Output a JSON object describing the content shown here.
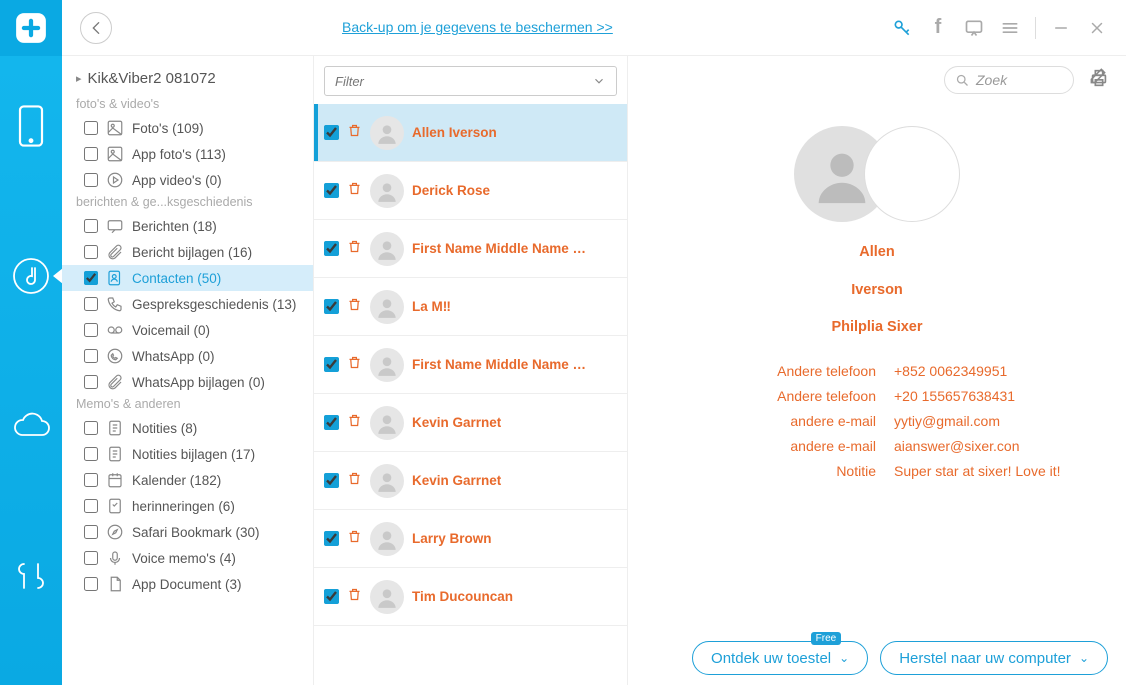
{
  "topbar": {
    "backup_link": "Back-up om je gegevens te beschermen >>"
  },
  "tools": {
    "search_placeholder": "Zoek"
  },
  "tree": {
    "title": "Kik&Viber2 081072",
    "groups": [
      {
        "label": "foto's & video's",
        "items": [
          {
            "id": "photos",
            "label": "Foto's (109)"
          },
          {
            "id": "app-photos",
            "label": "App foto's (113)"
          },
          {
            "id": "app-videos",
            "label": "App video's (0)"
          }
        ]
      },
      {
        "label": "berichten & ge...ksgeschiedenis",
        "items": [
          {
            "id": "messages",
            "label": "Berichten (18)"
          },
          {
            "id": "msg-attach",
            "label": "Bericht bijlagen (16)"
          },
          {
            "id": "contacts",
            "label": "Contacten (50)",
            "selected": true,
            "checked": true
          },
          {
            "id": "callhist",
            "label": "Gespreksgeschiedenis (13)"
          },
          {
            "id": "voicemail",
            "label": "Voicemail (0)"
          },
          {
            "id": "whatsapp",
            "label": "WhatsApp (0)"
          },
          {
            "id": "whatsapp-att",
            "label": "WhatsApp bijlagen (0)"
          }
        ]
      },
      {
        "label": "Memo's & anderen",
        "items": [
          {
            "id": "notes",
            "label": "Notities (8)"
          },
          {
            "id": "notes-att",
            "label": "Notities bijlagen (17)"
          },
          {
            "id": "calendar",
            "label": "Kalender (182)"
          },
          {
            "id": "reminders",
            "label": "herinneringen (6)"
          },
          {
            "id": "safari",
            "label": "Safari Bookmark (30)"
          },
          {
            "id": "voicememo",
            "label": "Voice memo's (4)"
          },
          {
            "id": "appdoc",
            "label": "App Document (3)"
          }
        ]
      }
    ]
  },
  "filter": {
    "label": "Filter"
  },
  "contacts": [
    {
      "name": "Allen  Iverson",
      "active": true
    },
    {
      "name": "Derick Rose"
    },
    {
      "name": "First Name Middle Name La..."
    },
    {
      "name": "La M‼"
    },
    {
      "name": "First Name Middle Name La..."
    },
    {
      "name": "Kevin Garrnet"
    },
    {
      "name": "Kevin Garrnet"
    },
    {
      "name": "Larry Brown"
    },
    {
      "name": "Tim  Ducouncan"
    }
  ],
  "detail": {
    "first": "Allen",
    "last": "Iverson",
    "company": "Philplia Sixer",
    "fields": [
      {
        "label": "Andere telefoon",
        "value": "+852 0062349951"
      },
      {
        "label": "Andere telefoon",
        "value": "+20 155657638431"
      },
      {
        "label": "andere e-mail",
        "value": "yytiy@gmail.com"
      },
      {
        "label": "andere e-mail",
        "value": "aianswer@sixer.con"
      },
      {
        "label": "Notitie",
        "value": "Super star at sixer! Love it!"
      }
    ]
  },
  "footer": {
    "discover": "Ontdek uw toestel",
    "free": "Free",
    "restore": "Herstel naar uw computer"
  }
}
